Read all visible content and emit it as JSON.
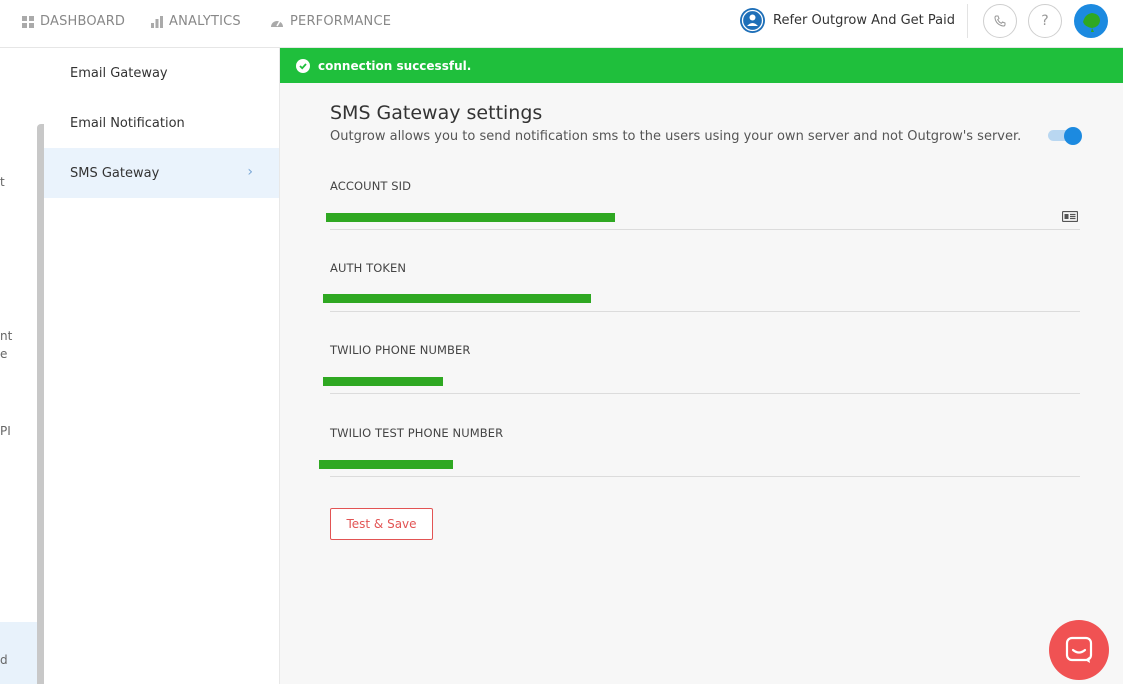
{
  "nav": {
    "items": [
      {
        "label": "DASHBOARD",
        "icon": "grid-icon"
      },
      {
        "label": "ANALYTICS",
        "icon": "bar-chart-icon"
      },
      {
        "label": "PERFORMANCE",
        "icon": "speedometer-icon"
      }
    ],
    "refer_label": "Refer Outgrow And Get Paid"
  },
  "leftstrip": {
    "fragments": [
      "t",
      "nt",
      "e",
      "PI",
      "d"
    ]
  },
  "sidebar": {
    "items": [
      {
        "label": "Email Gateway"
      },
      {
        "label": "Email Notification"
      },
      {
        "label": "SMS Gateway",
        "active": true
      }
    ]
  },
  "banner": {
    "message": "connection successful."
  },
  "settings": {
    "title": "SMS Gateway settings",
    "description": "Outgrow allows you to send notification sms to the users using your own server and not Outgrow's server.",
    "enabled": true,
    "fields": [
      {
        "label": "ACCOUNT SID"
      },
      {
        "label": "AUTH TOKEN"
      },
      {
        "label": "TWILIO PHONE NUMBER"
      },
      {
        "label": "TWILIO TEST PHONE NUMBER"
      }
    ],
    "save_label": "Test & Save"
  },
  "colors": {
    "accent": "#1c8ae0",
    "success": "#1fbf3c",
    "danger": "#e25454",
    "chat": "#f05253"
  }
}
